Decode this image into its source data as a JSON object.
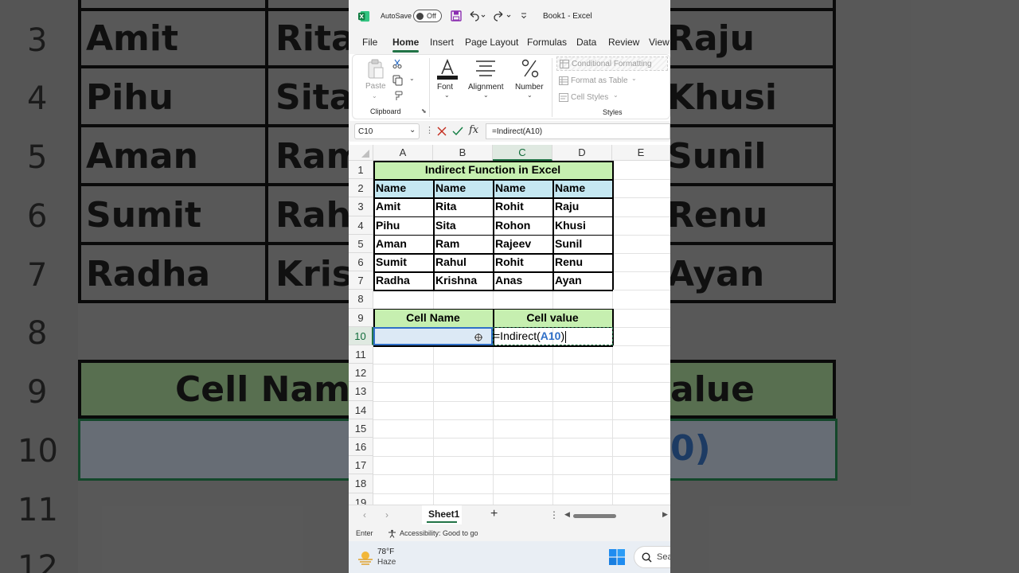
{
  "background": {
    "row_numbers": [
      "3",
      "4",
      "5",
      "6",
      "7",
      "8",
      "9",
      "10",
      "11",
      "12"
    ],
    "col_a": [
      "Amit",
      "Pihu",
      "Aman",
      "Sumit",
      "Radha"
    ],
    "col_b": [
      "Rita",
      "Sita",
      "Ram",
      "Rah",
      "Kris"
    ],
    "col_d": [
      "Raju",
      "Khusi",
      "Sunil",
      "Renu",
      "Ayan"
    ],
    "row9_left": "Cell Name",
    "row9_right": "alue",
    "row10_right": "0)"
  },
  "titlebar": {
    "autosave_label": "AutoSave",
    "autosave_state": "Off",
    "title": "Book1  -  Excel"
  },
  "tabs": [
    "File",
    "Home",
    "Insert",
    "Page Layout",
    "Formulas",
    "Data",
    "Review",
    "View"
  ],
  "ribbon": {
    "paste": "Paste",
    "clipboard": "Clipboard",
    "font": "Font",
    "alignment": "Alignment",
    "number": "Number",
    "conditional_formatting": "Conditional Formatting",
    "format_as_table": "Format as Table",
    "cell_styles": "Cell Styles",
    "styles": "Styles"
  },
  "formula_bar": {
    "name_box": "C10",
    "formula": "=Indirect(A10)"
  },
  "columns": [
    "A",
    "B",
    "C",
    "D",
    "E"
  ],
  "rows": [
    "1",
    "2",
    "3",
    "4",
    "5",
    "6",
    "7",
    "8",
    "9",
    "10",
    "11",
    "12",
    "13",
    "14",
    "15",
    "16",
    "17",
    "18",
    "19"
  ],
  "sheet": {
    "title": "Indirect Function in Excel",
    "headers": [
      "Name",
      "Name",
      "Name",
      "Name"
    ],
    "data": [
      [
        "Amit",
        "Rita",
        "Rohit",
        "Raju"
      ],
      [
        "Pihu",
        "Sita",
        "Rohon",
        "Khusi"
      ],
      [
        "Aman",
        "Ram",
        "Rajeev",
        "Sunil"
      ],
      [
        "Sumit",
        "Rahul",
        "Rohit",
        "Renu"
      ],
      [
        "Radha",
        "Krishna",
        "Anas",
        "Ayan"
      ]
    ],
    "cell_name_label": "Cell Name",
    "cell_value_label": "Cell value",
    "edit_prefix": "=Indirect(",
    "edit_ref": "A10",
    "edit_suffix": ")"
  },
  "sheet_tabs": {
    "active": "Sheet1"
  },
  "status": {
    "mode": "Enter",
    "accessibility": "Accessibility: Good to go"
  },
  "taskbar": {
    "temp": "78°F",
    "weather": "Haze",
    "search": "Sea"
  },
  "colors": {
    "excel_green": "#217346",
    "title_fill": "#c6efb0",
    "header_fill": "#c5e8f2",
    "ref_blue": "#2f6fc7"
  }
}
